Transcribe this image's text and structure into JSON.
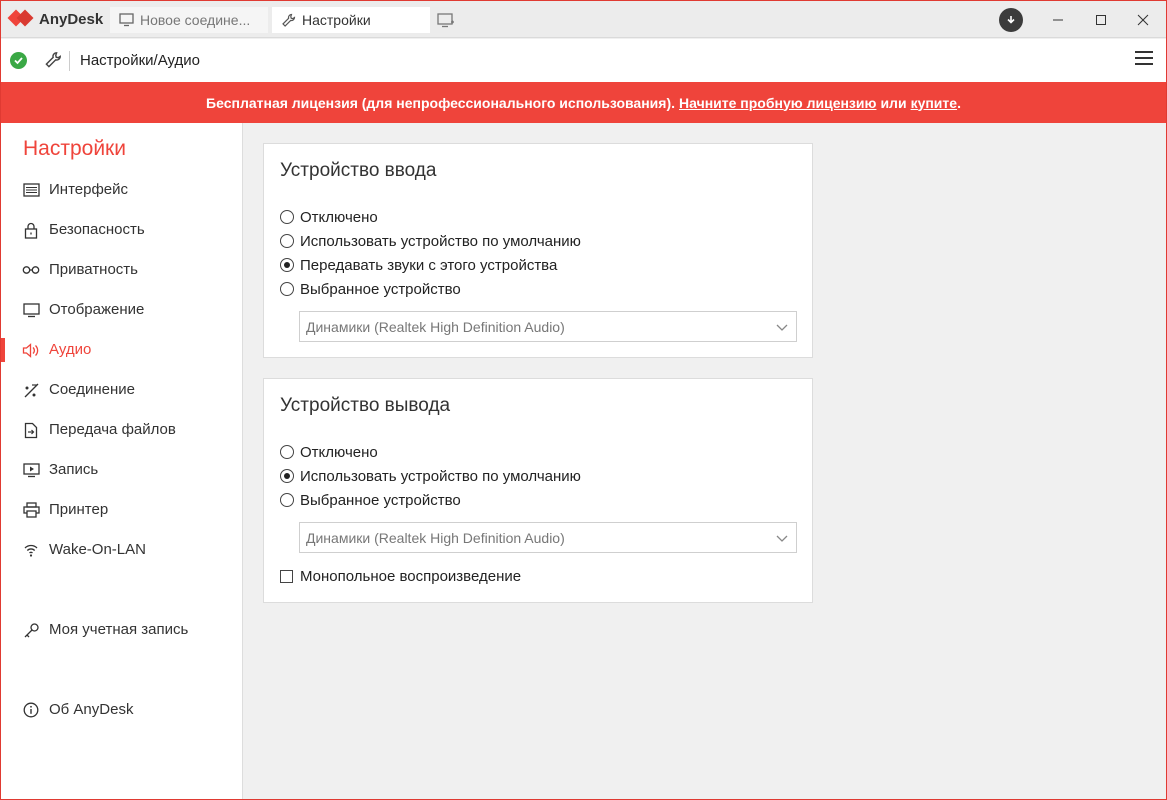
{
  "app": {
    "name": "AnyDesk"
  },
  "tabs": [
    {
      "label": "Новое соедине...",
      "icon": "monitor-icon",
      "active": false
    },
    {
      "label": "Настройки",
      "icon": "wrench-icon",
      "active": true
    }
  ],
  "address": {
    "path": "Настройки/Аудио"
  },
  "banner": {
    "text": "Бесплатная лицензия (для непрофессионального использования).",
    "trial_link": "Начните пробную лицензию",
    "or_text": "или",
    "buy_link": "купите",
    "end": "."
  },
  "sidebar": {
    "title": "Настройки",
    "items": [
      {
        "label": "Интерфейс",
        "icon": "interface-icon"
      },
      {
        "label": "Безопасность",
        "icon": "lock-icon"
      },
      {
        "label": "Приватность",
        "icon": "glasses-icon"
      },
      {
        "label": "Отображение",
        "icon": "display-icon"
      },
      {
        "label": "Аудио",
        "icon": "speaker-icon",
        "active": true
      },
      {
        "label": "Соединение",
        "icon": "connection-icon"
      },
      {
        "label": "Передача файлов",
        "icon": "file-transfer-icon"
      },
      {
        "label": "Запись",
        "icon": "recording-icon"
      },
      {
        "label": "Принтер",
        "icon": "printer-icon"
      },
      {
        "label": "Wake-On-LAN",
        "icon": "wifi-icon"
      },
      {
        "label": "Моя учетная запись",
        "icon": "key-icon"
      },
      {
        "label": "Об AnyDesk",
        "icon": "info-icon"
      }
    ]
  },
  "input_device": {
    "title": "Устройство ввода",
    "options": [
      {
        "label": "Отключено",
        "checked": false
      },
      {
        "label": "Использовать устройство по умолчанию",
        "checked": false
      },
      {
        "label": "Передавать звуки с этого устройства",
        "checked": true
      },
      {
        "label": "Выбранное устройство",
        "checked": false
      }
    ],
    "device_select": "Динамики (Realtek High Definition Audio)"
  },
  "output_device": {
    "title": "Устройство вывода",
    "options": [
      {
        "label": "Отключено",
        "checked": false
      },
      {
        "label": "Использовать устройство по умолчанию",
        "checked": true
      },
      {
        "label": "Выбранное устройство",
        "checked": false
      }
    ],
    "device_select": "Динамики (Realtek High Definition Audio)",
    "exclusive_label": "Монопольное воспроизведение",
    "exclusive_checked": false
  },
  "colors": {
    "accent": "#ef443b",
    "ok": "#3aa845"
  }
}
